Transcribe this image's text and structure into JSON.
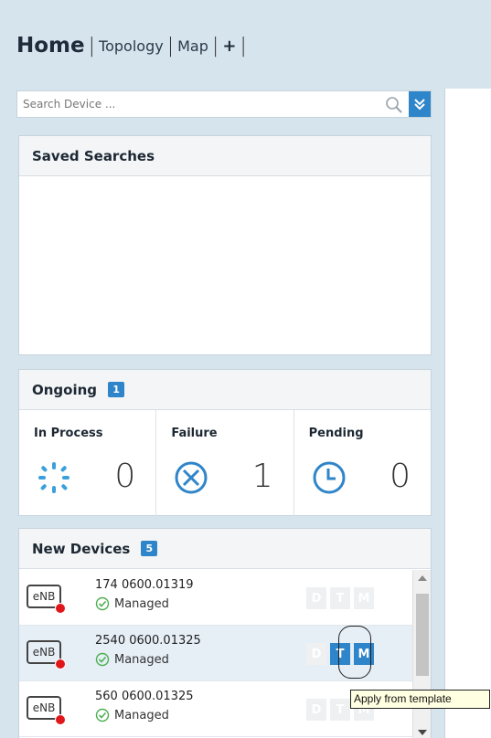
{
  "nav": {
    "home": "Home",
    "topology": "Topology",
    "map": "Map",
    "add": "+",
    "separator": "|"
  },
  "search": {
    "placeholder": "Search Device ...",
    "value": ""
  },
  "saved_searches": {
    "title": "Saved Searches"
  },
  "ongoing": {
    "title": "Ongoing",
    "count": "1",
    "columns": [
      {
        "label": "In Process",
        "value": "0",
        "icon": "spinner-icon"
      },
      {
        "label": "Failure",
        "value": "1",
        "icon": "failure-x-circle-icon"
      },
      {
        "label": "Pending",
        "value": "0",
        "icon": "clock-icon"
      }
    ]
  },
  "new_devices": {
    "title": "New Devices",
    "count": "5",
    "device_badge": "eNB",
    "buttons": [
      "D",
      "T",
      "M"
    ],
    "rows": [
      {
        "name": "174  0600.01319",
        "status": "Managed"
      },
      {
        "name": "2540  0600.01325",
        "status": "Managed"
      },
      {
        "name": "560  0600.01325",
        "status": "Managed"
      }
    ]
  },
  "tooltip": {
    "text": "Apply from template"
  },
  "colors": {
    "accent": "#2f85c9",
    "failure_icon": "#2f85c9",
    "status_ok": "#4caf50",
    "alarm_dot": "#e0161b"
  }
}
